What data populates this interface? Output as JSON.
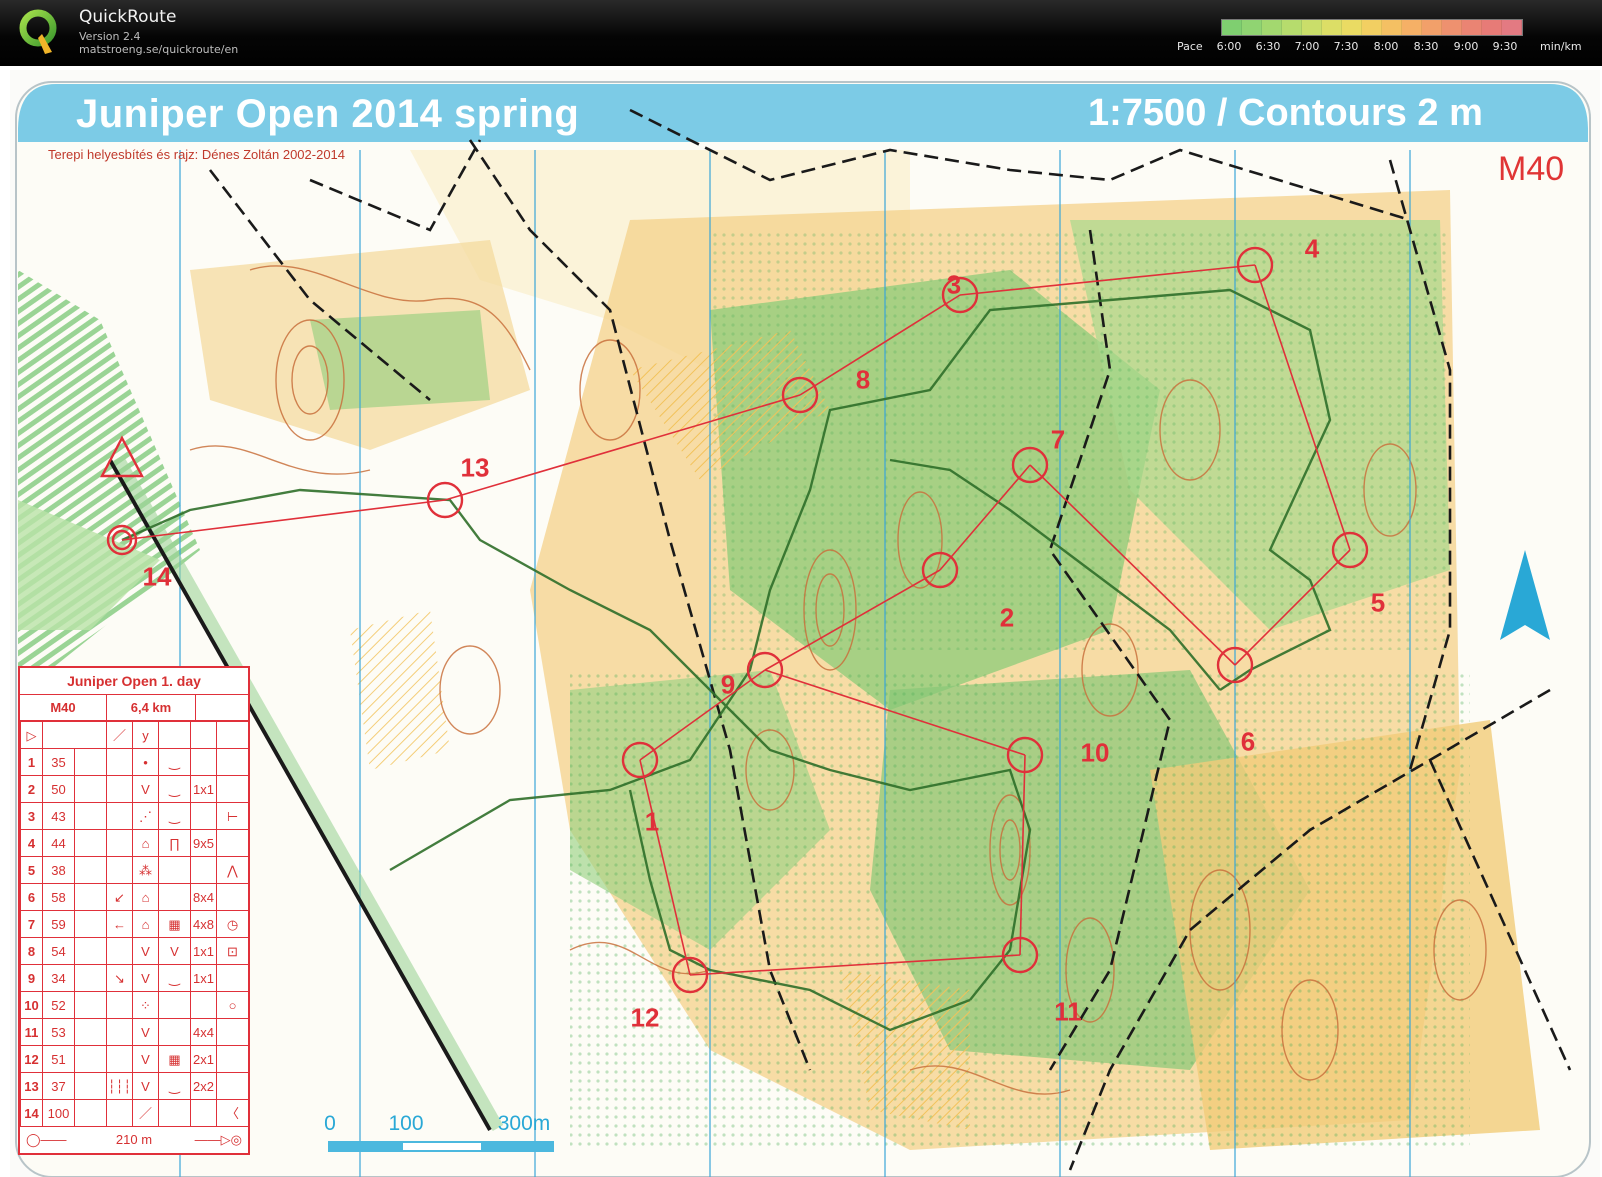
{
  "app": {
    "name": "QuickRoute",
    "version": "Version 2.4",
    "url": "matstroeng.se/quickroute/en"
  },
  "pace": {
    "label": "Pace",
    "unit": "min/km",
    "ticks": [
      "6:00",
      "6:30",
      "7:00",
      "7:30",
      "8:00",
      "8:30",
      "9:00",
      "9:30"
    ],
    "colors": [
      "#7fcf70",
      "#90d472",
      "#a3d86f",
      "#b6dc6d",
      "#cade6a",
      "#dcde66",
      "#eadb63",
      "#f2cf62",
      "#f4c063",
      "#f5b066",
      "#f2a06a",
      "#ee916f",
      "#ea8473",
      "#e77b77",
      "#e37a82"
    ]
  },
  "map": {
    "title": "Juniper Open 2014 spring",
    "scale_title": "1:7500 / Contours 2 m",
    "credit": "Terepi helyesbítés és rajz: Dénes Zoltán 2002-2014",
    "class_label": "M40",
    "controls": [
      {
        "num": "1"
      },
      {
        "num": "2"
      },
      {
        "num": "3"
      },
      {
        "num": "4"
      },
      {
        "num": "5"
      },
      {
        "num": "6"
      },
      {
        "num": "7"
      },
      {
        "num": "8"
      },
      {
        "num": "9"
      },
      {
        "num": "10"
      },
      {
        "num": "11"
      },
      {
        "num": "12"
      },
      {
        "num": "13"
      },
      {
        "num": "14"
      }
    ],
    "scale_bar": {
      "labels": [
        "0",
        "100",
        "300m"
      ]
    },
    "colors": {
      "course": "#e0303a",
      "north_arrow": "#29a8d6",
      "title_band": "#7ccbe6"
    }
  },
  "description_sheet": {
    "event": "Juniper Open 1. day",
    "class": "M40",
    "length": "6,4 km",
    "rows": [
      {
        "no": "1",
        "code": "35",
        "d": "",
        "e": "•",
        "f": "‿",
        "g": "",
        "h": ""
      },
      {
        "no": "2",
        "code": "50",
        "d": "",
        "e": "V",
        "f": "‿",
        "g": "1x1",
        "h": ""
      },
      {
        "no": "3",
        "code": "43",
        "d": "",
        "e": "⋰",
        "f": "‿",
        "g": "",
        "h": "⊢"
      },
      {
        "no": "4",
        "code": "44",
        "d": "",
        "e": "⌂",
        "f": "∏",
        "g": "9x5",
        "h": ""
      },
      {
        "no": "5",
        "code": "38",
        "d": "",
        "e": "⁂",
        "f": "",
        "g": "",
        "h": "⋀"
      },
      {
        "no": "6",
        "code": "58",
        "d": "↙",
        "e": "⌂",
        "f": "",
        "g": "8x4",
        "h": ""
      },
      {
        "no": "7",
        "code": "59",
        "d": "←",
        "e": "⌂",
        "f": "▦",
        "g": "4x8",
        "h": "◷"
      },
      {
        "no": "8",
        "code": "54",
        "d": "",
        "e": "V",
        "f": "V",
        "g": "1x1",
        "h": "⊡"
      },
      {
        "no": "9",
        "code": "34",
        "d": "↘",
        "e": "V",
        "f": "‿",
        "g": "1x1",
        "h": ""
      },
      {
        "no": "10",
        "code": "52",
        "d": "",
        "e": "⁘",
        "f": "",
        "g": "",
        "h": "○"
      },
      {
        "no": "11",
        "code": "53",
        "d": "",
        "e": "V",
        "f": "",
        "g": "4x4",
        "h": ""
      },
      {
        "no": "12",
        "code": "51",
        "d": "",
        "e": "V",
        "f": "▦",
        "g": "2x1",
        "h": ""
      },
      {
        "no": "13",
        "code": "37",
        "d": "┆┆┆",
        "e": "V",
        "f": "‿",
        "g": "2x2",
        "h": ""
      },
      {
        "no": "14",
        "code": "100",
        "d": "",
        "e": "／",
        "f": "",
        "g": "",
        "h": "〈"
      }
    ],
    "finish_distance": "210 m"
  }
}
